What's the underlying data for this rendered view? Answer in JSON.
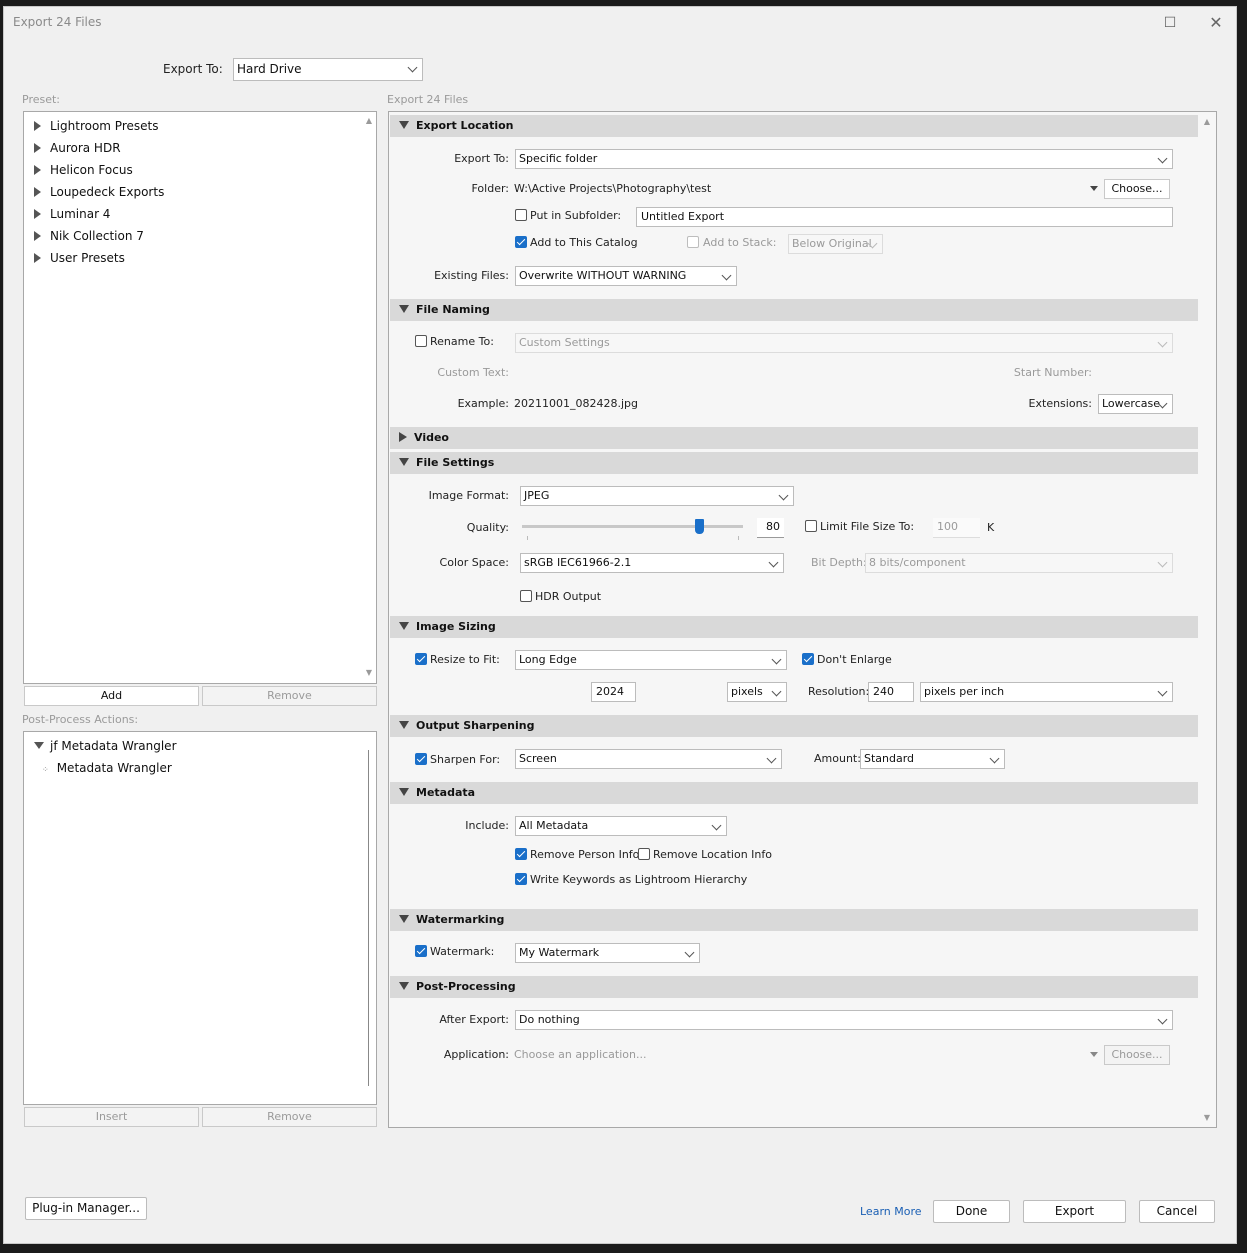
{
  "window": {
    "title": "Export 24 Files"
  },
  "export_to": {
    "label": "Export To:",
    "value": "Hard Drive"
  },
  "preset": {
    "label": "Preset:",
    "items": [
      "Lightroom Presets",
      "Aurora HDR",
      "Helicon Focus",
      "Loupedeck Exports",
      "Luminar 4",
      "Nik Collection 7",
      "User Presets"
    ],
    "add": "Add",
    "remove": "Remove"
  },
  "post_process": {
    "label": "Post-Process Actions:",
    "parent": "jf Metadata Wrangler",
    "child": "Metadata Wrangler",
    "insert": "Insert",
    "remove": "Remove"
  },
  "right_title": "Export 24 Files",
  "sections": {
    "export_location": {
      "title": "Export Location",
      "export_to_label": "Export To:",
      "export_to_value": "Specific folder",
      "folder_label": "Folder:",
      "folder_value": "W:\\Active Projects\\Photography\\test",
      "choose": "Choose...",
      "subfolder_label": "Put in Subfolder:",
      "subfolder_value": "Untitled Export",
      "add_catalog": "Add to This Catalog",
      "add_stack": "Add to Stack:",
      "stack_value": "Below Original",
      "existing_label": "Existing Files:",
      "existing_value": "Overwrite WITHOUT WARNING"
    },
    "file_naming": {
      "title": "File Naming",
      "rename_label": "Rename To:",
      "rename_value": "Custom Settings",
      "custom_text": "Custom Text:",
      "start_number": "Start Number:",
      "example_label": "Example:",
      "example_value": "20211001_082428.jpg",
      "extensions_label": "Extensions:",
      "extensions_value": "Lowercase"
    },
    "video": {
      "title": "Video"
    },
    "file_settings": {
      "title": "File Settings",
      "format_label": "Image Format:",
      "format_value": "JPEG",
      "quality_label": "Quality:",
      "quality_value": "80",
      "quality_fraction": 0.8,
      "limit_label": "Limit File Size To:",
      "limit_value": "100",
      "limit_unit": "K",
      "colorspace_label": "Color Space:",
      "colorspace_value": "sRGB IEC61966-2.1",
      "bitdepth_label": "Bit Depth:",
      "bitdepth_value": "8 bits/component",
      "hdr_label": "HDR Output"
    },
    "image_sizing": {
      "title": "Image Sizing",
      "resize_label": "Resize to Fit:",
      "resize_value": "Long Edge",
      "dont_enlarge": "Don't Enlarge",
      "size_value": "2024",
      "size_unit": "pixels",
      "resolution_label": "Resolution:",
      "resolution_value": "240",
      "resolution_unit": "pixels per inch"
    },
    "output_sharpening": {
      "title": "Output Sharpening",
      "sharpen_label": "Sharpen For:",
      "sharpen_value": "Screen",
      "amount_label": "Amount:",
      "amount_value": "Standard"
    },
    "metadata": {
      "title": "Metadata",
      "include_label": "Include:",
      "include_value": "All Metadata",
      "remove_person": "Remove Person Info",
      "remove_location": "Remove Location Info",
      "write_keywords": "Write Keywords as Lightroom Hierarchy"
    },
    "watermarking": {
      "title": "Watermarking",
      "watermark_label": "Watermark:",
      "watermark_value": "My Watermark"
    },
    "post_processing": {
      "title": "Post-Processing",
      "after_label": "After Export:",
      "after_value": "Do nothing",
      "app_label": "Application:",
      "app_placeholder": "Choose an application...",
      "choose": "Choose..."
    }
  },
  "footer": {
    "plugin_manager": "Plug-in Manager...",
    "learn_more": "Learn More",
    "done": "Done",
    "export": "Export",
    "cancel": "Cancel"
  },
  "colors": {
    "accent": "#1a6fc9",
    "link": "#1a5fb4"
  }
}
